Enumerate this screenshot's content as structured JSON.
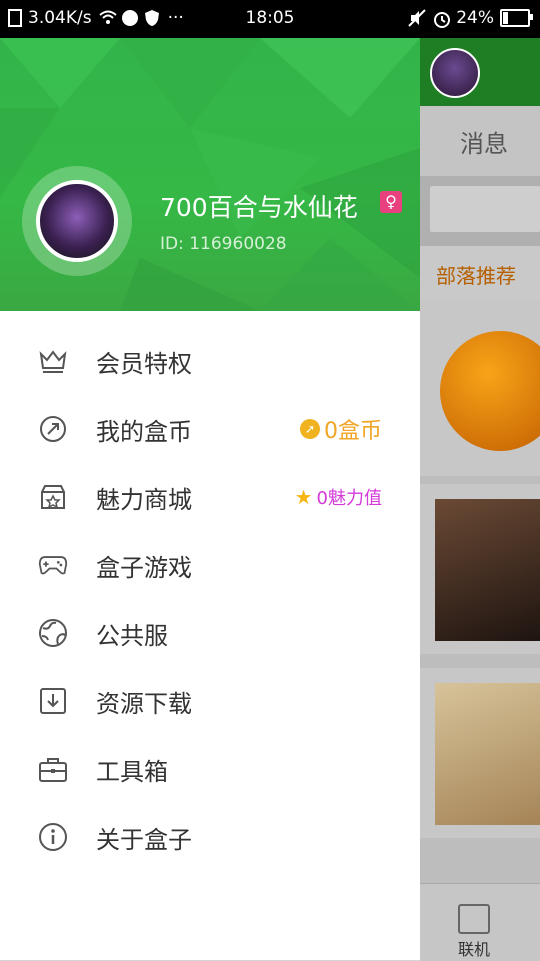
{
  "status_bar": {
    "speed": "3.04K/s",
    "time": "18:05",
    "battery": "24%",
    "battery_level": 0.24
  },
  "drawer": {
    "username": "700百合与水仙花",
    "user_id": "ID: 116960028",
    "gender_icon": "female-icon",
    "menu": [
      {
        "label": "会员特权",
        "icon": "crown-icon"
      },
      {
        "label": "我的盒币",
        "icon": "compass-icon",
        "extra": "0盒币"
      },
      {
        "label": "魅力商城",
        "icon": "store-icon",
        "extra": "0魅力值"
      },
      {
        "label": "盒子游戏",
        "icon": "gamepad-icon"
      },
      {
        "label": "公共服",
        "icon": "globe-icon"
      },
      {
        "label": "资源下载",
        "icon": "download-icon"
      },
      {
        "label": "工具箱",
        "icon": "toolbox-icon"
      },
      {
        "label": "关于盒子",
        "icon": "info-icon"
      }
    ]
  },
  "background_app": {
    "tab_label": "消息",
    "section_label": "部落推荐",
    "bottom_nav_label": "联机"
  },
  "colors": {
    "header_green": "#35b845",
    "coin_orange": "#f0a526",
    "charm_pink": "#d43bd9"
  }
}
